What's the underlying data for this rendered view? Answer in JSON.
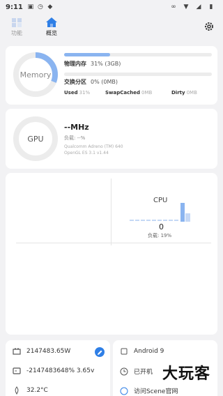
{
  "status": {
    "time": "9:11"
  },
  "tabs": [
    {
      "label": "功能",
      "icon": "function-icon"
    },
    {
      "label": "概览",
      "icon": "overview-home-icon"
    }
  ],
  "memory": {
    "ring_label": "Memory",
    "ram_label": "物理内存",
    "ram_value": "31% (3GB)",
    "ram_percent": 31,
    "swap_label": "交换分区",
    "swap_value": "0% (0MB)",
    "swap_percent": 0,
    "used_label": "Used",
    "used_value": "31%",
    "swapcached_label": "SwapCached",
    "swapcached_value": "0MB",
    "dirty_label": "Dirty",
    "dirty_value": "0MB"
  },
  "gpu": {
    "ring_label": "GPU",
    "freq": "--MHz",
    "load": "负载: --%",
    "renderer": "Qualcomm Adreno (TM) 640",
    "opengl": "OpenGL ES 3.1 v1.44"
  },
  "cpu": {
    "title": "CPU",
    "value": "0",
    "load": "负载: 19%"
  },
  "info_left": [
    {
      "icon": "battery-icon",
      "text": "2147483.65W"
    },
    {
      "icon": "battery-voltage-icon",
      "text": "-2147483648%  3.65v"
    },
    {
      "icon": "temperature-icon",
      "text": "32.2°C"
    }
  ],
  "info_right": [
    {
      "icon": "android-icon",
      "text": "Android 9"
    },
    {
      "icon": "clock-icon",
      "text": "已开机"
    },
    {
      "icon": "scene-icon",
      "text": "访问Scene官网"
    }
  ],
  "watermark": "大玩客",
  "colors": {
    "accent": "#8ab4f0",
    "edit": "#2f7fe6"
  }
}
